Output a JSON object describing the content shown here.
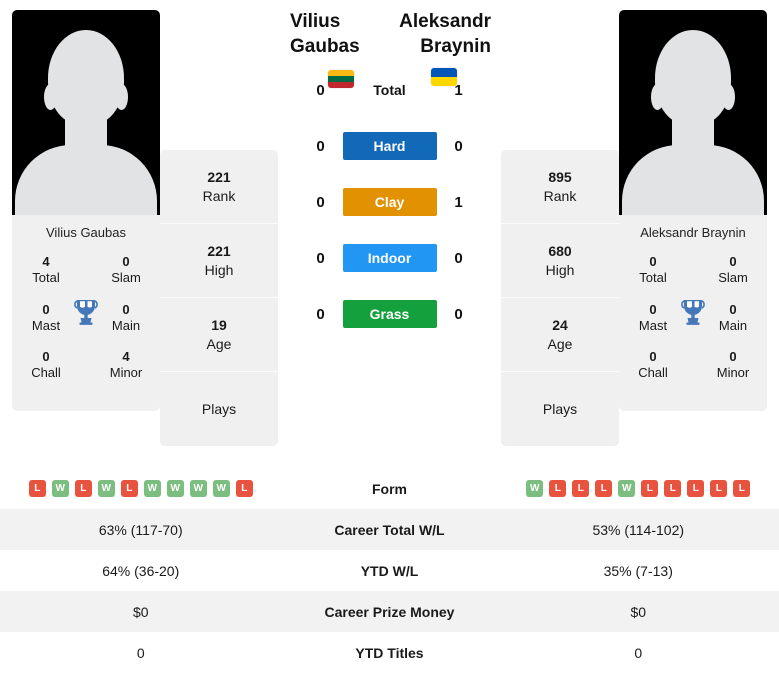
{
  "players": {
    "left": {
      "name": "Vilius Gaubas",
      "photo_name": "player-photo-placeholder",
      "flag": {
        "name": "lithuania-flag",
        "stripes": [
          "#fdb913",
          "#006a44",
          "#c1272d"
        ]
      },
      "stats": [
        {
          "value": "221",
          "label": "Rank"
        },
        {
          "value": "221",
          "label": "High"
        },
        {
          "value": "19",
          "label": "Age"
        },
        {
          "value": "",
          "label": "Plays"
        }
      ],
      "titles": {
        "caption": "Vilius Gaubas",
        "cells": [
          {
            "value": "4",
            "label": "Total"
          },
          {
            "value": "0",
            "label": "Slam"
          },
          {
            "value": "0",
            "label": "Mast"
          },
          {
            "value": "0",
            "label": "Main"
          },
          {
            "value": "0",
            "label": "Chall"
          },
          {
            "value": "4",
            "label": "Minor"
          }
        ]
      },
      "form": [
        "L",
        "W",
        "L",
        "W",
        "L",
        "W",
        "W",
        "W",
        "W",
        "L"
      ],
      "career_total_wl": "63% (117-70)",
      "ytd_wl": "64% (36-20)",
      "career_prize_money": "$0",
      "ytd_titles": "0"
    },
    "right": {
      "name": "Aleksandr Braynin",
      "photo_name": "player-photo-placeholder",
      "flag": {
        "name": "ukraine-flag",
        "stripes": [
          "#0057b7",
          "#ffd700"
        ]
      },
      "stats": [
        {
          "value": "895",
          "label": "Rank"
        },
        {
          "value": "680",
          "label": "High"
        },
        {
          "value": "24",
          "label": "Age"
        },
        {
          "value": "",
          "label": "Plays"
        }
      ],
      "titles": {
        "caption": "Aleksandr Braynin",
        "cells": [
          {
            "value": "0",
            "label": "Total"
          },
          {
            "value": "0",
            "label": "Slam"
          },
          {
            "value": "0",
            "label": "Mast"
          },
          {
            "value": "0",
            "label": "Main"
          },
          {
            "value": "0",
            "label": "Chall"
          },
          {
            "value": "0",
            "label": "Minor"
          }
        ]
      },
      "form": [
        "W",
        "L",
        "L",
        "L",
        "W",
        "L",
        "L",
        "L",
        "L",
        "L"
      ],
      "career_total_wl": "53% (114-102)",
      "ytd_wl": "35% (7-13)",
      "career_prize_money": "$0",
      "ytd_titles": "0"
    }
  },
  "head_to_head": [
    {
      "label": "Total",
      "left": "0",
      "right": "1",
      "color": "",
      "text_color": "#111111"
    },
    {
      "label": "Hard",
      "left": "0",
      "right": "0",
      "color": "#1169b8",
      "text_color": "#ffffff"
    },
    {
      "label": "Clay",
      "left": "0",
      "right": "1",
      "color": "#e29100",
      "text_color": "#ffffff"
    },
    {
      "label": "Indoor",
      "left": "0",
      "right": "0",
      "color": "#2196f3",
      "text_color": "#ffffff"
    },
    {
      "label": "Grass",
      "left": "0",
      "right": "0",
      "color": "#14a03c",
      "text_color": "#ffffff"
    }
  ],
  "table": {
    "rows": [
      {
        "label": "Form",
        "type": "form"
      },
      {
        "label": "Career Total W/L",
        "type": "text",
        "key": "career_total_wl"
      },
      {
        "label": "YTD W/L",
        "type": "text",
        "key": "ytd_wl"
      },
      {
        "label": "Career Prize Money",
        "type": "text",
        "key": "career_prize_money"
      },
      {
        "label": "YTD Titles",
        "type": "text",
        "key": "ytd_titles"
      }
    ]
  },
  "colors": {
    "win": "#7cbd80",
    "loss": "#e8533f",
    "panel": "#f0f0f0",
    "row_shade": "#f2f2f2",
    "trophy": "#4478b8"
  }
}
